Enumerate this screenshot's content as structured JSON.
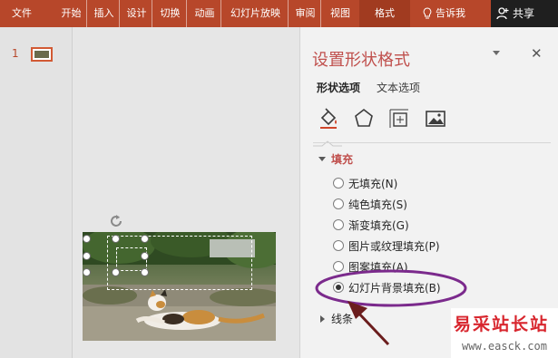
{
  "ribbon": {
    "tabs": [
      {
        "label": "文件"
      },
      {
        "label": "开始"
      },
      {
        "label": "插入"
      },
      {
        "label": "设计"
      },
      {
        "label": "切换"
      },
      {
        "label": "动画"
      },
      {
        "label": "幻灯片放映"
      },
      {
        "label": "审阅"
      },
      {
        "label": "视图"
      },
      {
        "label": "格式"
      }
    ],
    "active_tab": "格式",
    "tell_me": "告诉我",
    "share": "共享",
    "color": "#b7472a"
  },
  "thumbnails": {
    "slide_number": "1"
  },
  "format_pane": {
    "title": "设置形状格式",
    "tabs": [
      {
        "label": "形状选项",
        "active": true
      },
      {
        "label": "文本选项",
        "active": false
      }
    ],
    "icon_buttons": [
      "fill-line-icon",
      "effects-pentagon-icon",
      "size-properties-icon",
      "picture-icon"
    ],
    "fill_section": {
      "label": "填充",
      "expanded": true,
      "options": [
        {
          "label": "无填充(N)",
          "checked": false
        },
        {
          "label": "纯色填充(S)",
          "checked": false
        },
        {
          "label": "渐变填充(G)",
          "checked": false
        },
        {
          "label": "图片或纹理填充(P)",
          "checked": false
        },
        {
          "label": "图案填充(A)",
          "checked": false
        },
        {
          "label": "幻灯片背景填充(B)",
          "checked": true
        }
      ]
    },
    "line_section": {
      "label": "线条",
      "expanded": false
    },
    "accent_color": "#c0504d"
  },
  "annotation": {
    "ellipse_color": "#7b2a8c",
    "arrow_color": "#6b1d1d"
  },
  "watermark": {
    "title": "易采站长站",
    "url": "www.easck.com"
  }
}
